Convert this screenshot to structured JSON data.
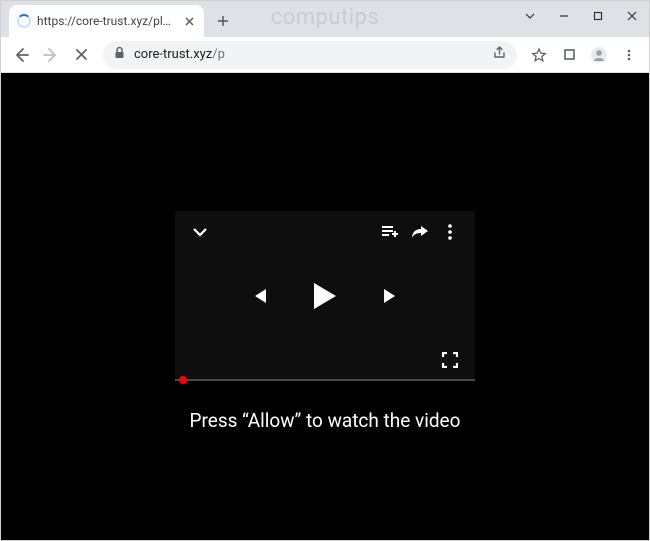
{
  "window": {
    "watermark": "computips"
  },
  "tab": {
    "title": "https://core-trust.xyz/play-music"
  },
  "address": {
    "domain": "core-trust.xyz",
    "path": "/p"
  },
  "page": {
    "prompt": "Press “Allow” to watch the video"
  }
}
